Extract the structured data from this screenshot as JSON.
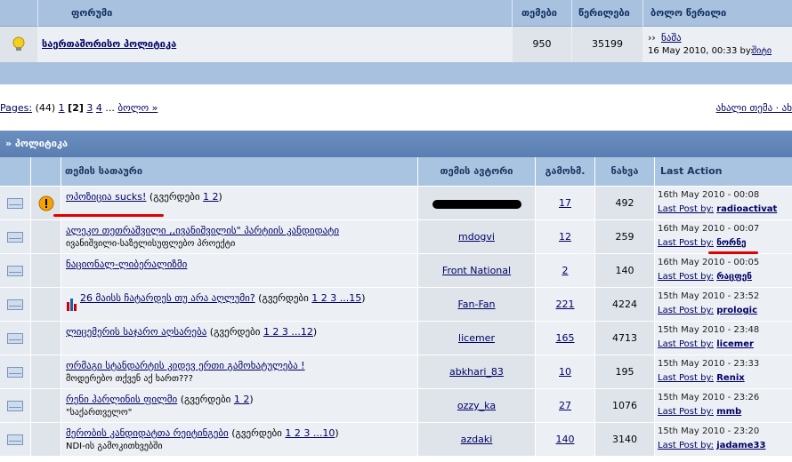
{
  "forum_header": {
    "col_forums": "ფორუმი",
    "col_topics": "თემები",
    "col_posts": "წერილები",
    "col_last": "ბოლო წერილი"
  },
  "forum_row": {
    "name": "საერთაშორისო პოლიტიკა",
    "topics": "950",
    "posts": "35199",
    "last_prefix": "››",
    "last_title": "ნაშა",
    "last_date": "16 May 2010, 00:33 by:",
    "last_user": "შიტი"
  },
  "pager": {
    "pages_label": "Pages:",
    "count": "(44)",
    "p1": "1",
    "current": "[2]",
    "p3": "3",
    "p4": "4",
    "dots": "...",
    "last": "ბოლო »"
  },
  "new_topic": "ახალი თემა · ახ",
  "category": "» პოლიტიკა",
  "table_header": {
    "title": "თემის სათაური",
    "author": "თემის ავტორი",
    "replies": "გამოხმ.",
    "views": "ნახვა",
    "last_action": "Last Action"
  },
  "colors": {
    "header": "#a7c1df",
    "category": "#5a7eb1",
    "red_underline": "#e00000"
  },
  "rows": [
    {
      "title": "ოპოზიცია sucks!",
      "pages_label": "(გვერდები",
      "pages": "1 2",
      "pages_end": ")",
      "subtitle": "",
      "author": "",
      "replies": "17",
      "views": "492",
      "last_date": "16th May 2010 - 00:08",
      "last_label": "Last Post by:",
      "last_user": "radioactivat",
      "icon": "exclamation-icon"
    },
    {
      "title": "ალეკო თეთრაშვილი ,,ივანიშვილის\" პარტიის კანდიდატი",
      "pages_label": "",
      "pages": "",
      "pages_end": "",
      "subtitle": "ივანიშვილი-საზელისუფლებო პროექტი",
      "author": "mdogvi",
      "replies": "12",
      "views": "259",
      "last_date": "16th May 2010 - 00:07",
      "last_label": "Last Post by:",
      "last_user": "ნორნე",
      "icon": ""
    },
    {
      "title": "ნაციონალ-ლიბერალიზმი",
      "pages_label": "",
      "pages": "",
      "pages_end": "",
      "subtitle": "",
      "author": "Front National",
      "replies": "2",
      "views": "140",
      "last_date": "16th May 2010 - 00:05",
      "last_label": "Last Post by:",
      "last_user": "რაცფენ",
      "icon": ""
    },
    {
      "title": "26 მაისს ჩატარდეს თუ არა აღლუმი?",
      "pages_label": "(გვერდები",
      "pages": "1 2 3 ...15",
      "pages_end": ")",
      "subtitle": "",
      "author": "Fan-Fan",
      "replies": "221",
      "views": "4224",
      "last_date": "15th May 2010 - 23:52",
      "last_label": "Last Post by:",
      "last_user": "prologic",
      "icon": "poll-icon"
    },
    {
      "title": "ლიცემერის საჯარო აღსარება",
      "pages_label": "(გვერდები",
      "pages": "1 2 3 ...12",
      "pages_end": ")",
      "subtitle": "",
      "author": "licemer",
      "replies": "165",
      "views": "4713",
      "last_date": "15th May 2010 - 23:48",
      "last_label": "Last Post by:",
      "last_user": "licemer",
      "icon": ""
    },
    {
      "title": "ორმაგი სტანდარტის კიდევ ერთი გამოხატულება !",
      "pages_label": "",
      "pages": "",
      "pages_end": "",
      "subtitle": "მოდერებო თქვენ აქ ხართ???",
      "author": "abkhari_83",
      "replies": "10",
      "views": "195",
      "last_date": "15th May 2010 - 23:33",
      "last_label": "Last Post by:",
      "last_user": "Renix",
      "icon": ""
    },
    {
      "title": "რენი ჰარლინის ფილმი",
      "pages_label": "(გვერდები",
      "pages": "1 2",
      "pages_end": ")",
      "subtitle": "\"საქართველო\"",
      "author": "ozzy_ka",
      "replies": "27",
      "views": "1076",
      "last_date": "15th May 2010 - 23:26",
      "last_label": "Last Post by:",
      "last_user": "mmb",
      "icon": ""
    },
    {
      "title": "მერობის კანდიდატთა რეიტინგები",
      "pages_label": "(გვერდები",
      "pages": "1 2 3 ...10",
      "pages_end": ")",
      "subtitle": "NDI-ის გამოკითხვებში",
      "author": "azdaki",
      "replies": "140",
      "views": "3140",
      "last_date": "15th May 2010 - 23:20",
      "last_label": "Last Post by:",
      "last_user": "jadame33",
      "icon": ""
    }
  ]
}
